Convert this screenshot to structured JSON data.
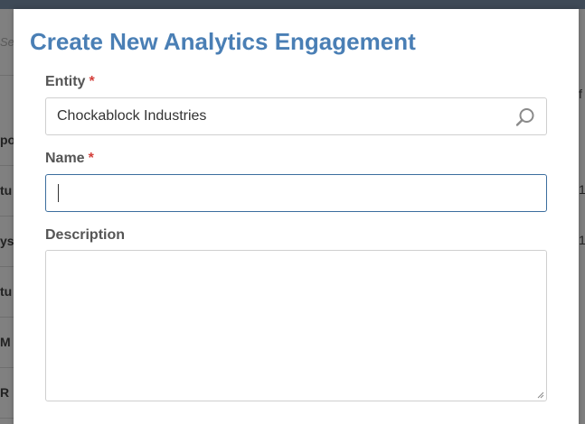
{
  "modal": {
    "title": "Create New Analytics Engagement",
    "required_marker": "*",
    "fields": {
      "entity": {
        "label": "Entity",
        "value": "Chockablock Industries"
      },
      "name": {
        "label": "Name",
        "value": ""
      },
      "description": {
        "label": "Description",
        "value": ""
      }
    }
  },
  "background": {
    "left_cells": [
      "Sea",
      "po",
      "tu",
      "ysi",
      "tu",
      "M",
      "R"
    ],
    "right_cells": [
      "f",
      "1",
      "1"
    ]
  },
  "colors": {
    "title": "#4a7fb5",
    "required": "#d43f3a",
    "focus_border": "#3c6e9e"
  },
  "icons": {
    "entity_lookup": "search-icon"
  }
}
